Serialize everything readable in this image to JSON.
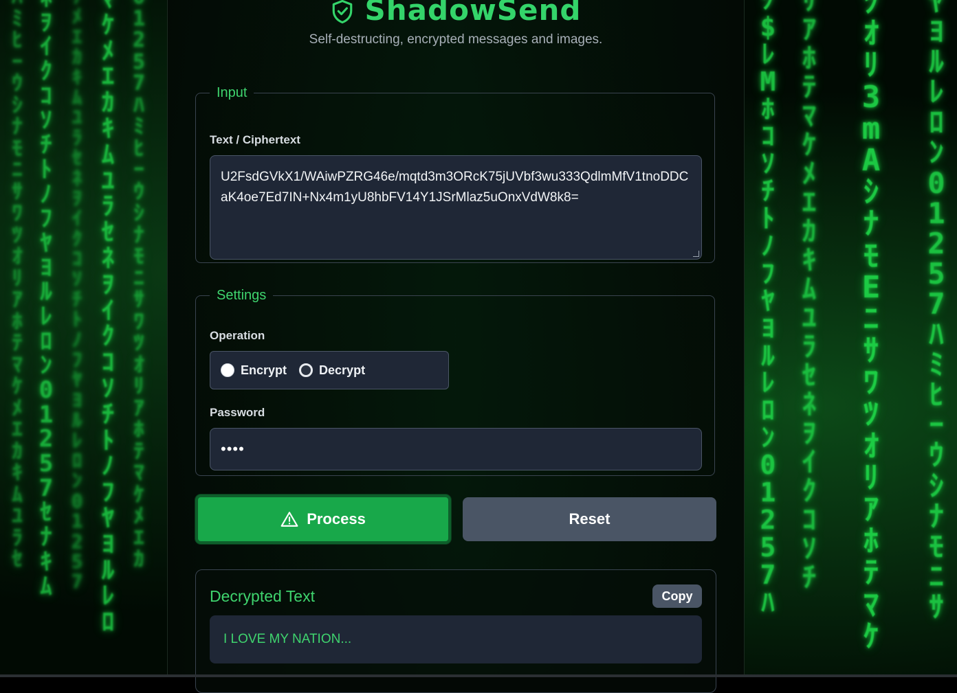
{
  "header": {
    "app_title": "ShadowSend",
    "subtitle": "Self-destructing, encrypted messages and images."
  },
  "input_section": {
    "legend": "Input",
    "field_label": "Text / Ciphertext",
    "ciphertext_value": "U2FsdGVkX1/WAiwPZRG46e/mqtd3m3ORcK75jUVbf3wu333QdlmMfV1tnoDDCaK4oe7Ed7IN+Nx4m1yU8hbFV14Y1JSrMlaz5uOnxVdW8k8="
  },
  "settings_section": {
    "legend": "Settings",
    "operation_label": "Operation",
    "operations": [
      {
        "label": "Encrypt",
        "selected": false
      },
      {
        "label": "Decrypt",
        "selected": true
      }
    ],
    "password_label": "Password",
    "password_value": "••••"
  },
  "actions": {
    "process_label": "Process",
    "reset_label": "Reset"
  },
  "result": {
    "title": "Decrypted Text",
    "copy_label": "Copy",
    "text": "I LOVE MY NATION..."
  },
  "colors": {
    "accent_green": "#34d46a",
    "process_button": "#18a84a",
    "secondary_button": "#4a5565",
    "field_background": "#1f2736"
  }
}
